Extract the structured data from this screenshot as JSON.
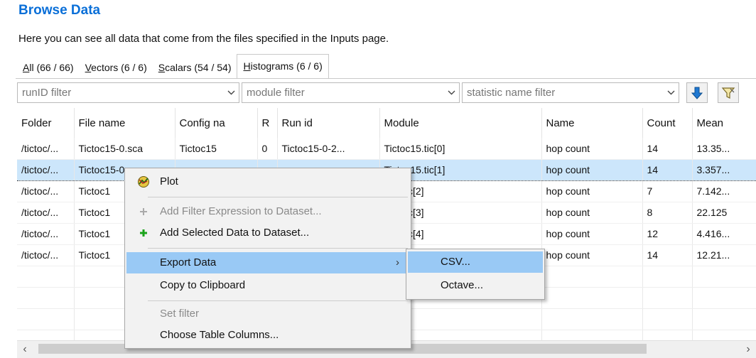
{
  "page": {
    "title": "Browse Data",
    "description": "Here you can see all data that come from the files specified in the Inputs page."
  },
  "tabs": [
    {
      "mnemonic": "A",
      "rest": "ll (66 / 66)"
    },
    {
      "mnemonic": "V",
      "rest": "ectors (6 / 6)"
    },
    {
      "mnemonic": "S",
      "rest": "calars (54 / 54)"
    },
    {
      "mnemonic": "H",
      "rest": "istograms (6 / 6)"
    }
  ],
  "filters": {
    "run_placeholder": "runID filter",
    "module_placeholder": "module filter",
    "statistic_placeholder": "statistic name filter"
  },
  "table": {
    "columns": [
      "Folder",
      "File name",
      "Config na",
      "R",
      "Run id",
      "Module",
      "Name",
      "Count",
      "Mean"
    ],
    "rows": [
      [
        "/tictoc/...",
        "Tictoc15-0.sca",
        "Tictoc15",
        "0",
        "Tictoc15-0-2...",
        "Tictoc15.tic[0]",
        "hop count",
        "14",
        "13.35..."
      ],
      [
        "/tictoc/...",
        "Tictoc15-0",
        "",
        "",
        "",
        "Tictoc15.tic[1]",
        "hop count",
        "14",
        "3.357..."
      ],
      [
        "/tictoc/...",
        "Tictoc1",
        "",
        "",
        "",
        "c15.tic[2]",
        "hop count",
        "7",
        "7.142..."
      ],
      [
        "/tictoc/...",
        "Tictoc1",
        "",
        "",
        "",
        "c15.tic[3]",
        "hop count",
        "8",
        "22.125"
      ],
      [
        "/tictoc/...",
        "Tictoc1",
        "",
        "",
        "",
        "c15.tic[4]",
        "hop count",
        "12",
        "4.416..."
      ],
      [
        "/tictoc/...",
        "Tictoc1",
        "",
        "",
        "",
        "",
        "hop count",
        "14",
        "12.21..."
      ]
    ]
  },
  "context_menu": {
    "plot": "Plot",
    "add_filter": "Add Filter Expression to Dataset...",
    "add_selected": "Add Selected Data to Dataset...",
    "export": "Export Data",
    "copy": "Copy to Clipboard",
    "set_filter": "Set filter",
    "choose_columns": "Choose Table Columns..."
  },
  "submenu": {
    "csv": "CSV...",
    "octave": "Octave..."
  },
  "colors": {
    "title": "#0a6fd8",
    "selection": "#cce6fb",
    "menu_highlight": "#99c9f5",
    "add_icon": "#1aa31a"
  }
}
